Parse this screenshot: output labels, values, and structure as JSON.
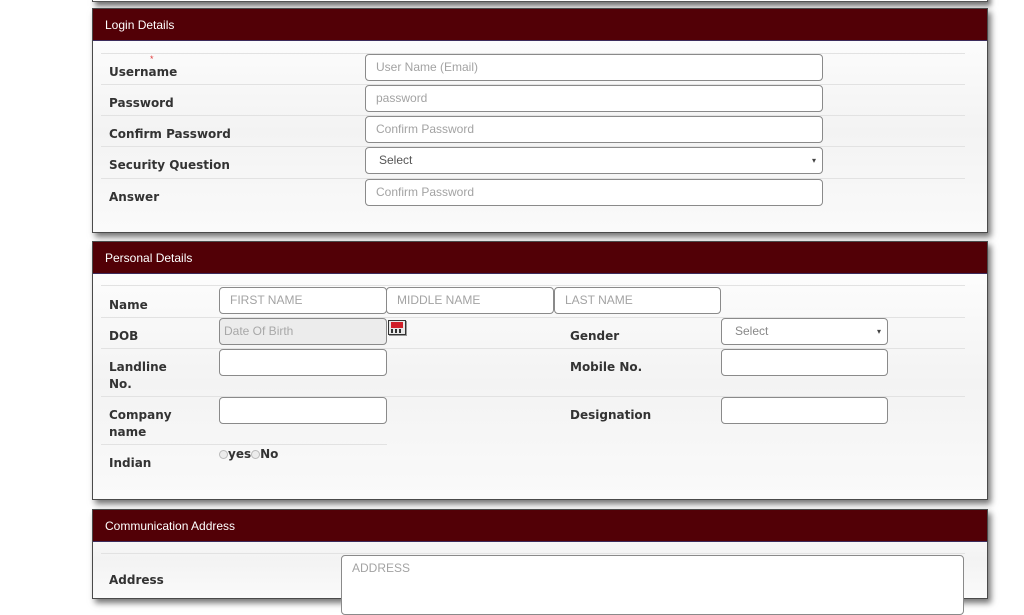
{
  "login_details": {
    "title": "Login Details",
    "required_mark": "*",
    "fields": [
      {
        "label": "Username",
        "placeholder": "User Name (Email)",
        "type": "text"
      },
      {
        "label": "Password",
        "placeholder": "password",
        "type": "password"
      },
      {
        "label": "Confirm Password",
        "placeholder": "Confirm Password",
        "type": "password"
      },
      {
        "label": "Security Question",
        "value": "Select",
        "type": "select"
      },
      {
        "label": "Answer",
        "placeholder": "Confirm Password",
        "type": "text"
      }
    ]
  },
  "personal_details": {
    "title": "Personal Details",
    "name_label": "Name",
    "first_name_placeholder": "FIRST NAME",
    "middle_name_placeholder": "MIDDLE NAME",
    "last_name_placeholder": "LAST NAME",
    "dob_label": "DOB",
    "dob_placeholder": "Date Of Birth",
    "gender_label": "Gender",
    "gender_value": "Select",
    "landline_label_line1": "Landline",
    "landline_label_line2": "No.",
    "mobile_label": "Mobile No.",
    "company_label_line1": "Company",
    "company_label_line2": "name",
    "designation_label": "Designation",
    "indian_label": "Indian",
    "indian_options": [
      "yes",
      "No"
    ]
  },
  "communication_address": {
    "title": "Communication Address",
    "address_label": "Address",
    "address_placeholder": "ADDRESS"
  },
  "colors": {
    "header_bg": "#520006",
    "header_text": "#ffffff"
  },
  "icons": {
    "calendar": "calendar-icon",
    "dropdown": "▾"
  }
}
